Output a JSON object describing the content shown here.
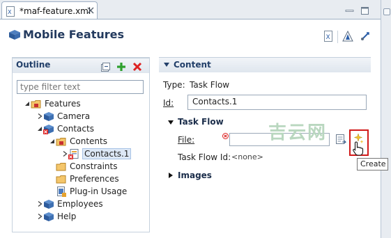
{
  "editor_tab": {
    "title": "*maf-feature.xml"
  },
  "header": {
    "title": "Mobile Features"
  },
  "outline": {
    "title": "Outline",
    "filter_placeholder": "type filter text",
    "tree": [
      {
        "label": "Features"
      },
      {
        "label": "Camera"
      },
      {
        "label": "Contacts"
      },
      {
        "label": "Contents"
      },
      {
        "label": "Contacts.1"
      },
      {
        "label": "Constraints"
      },
      {
        "label": "Preferences"
      },
      {
        "label": "Plug-in Usage"
      },
      {
        "label": "Employees"
      },
      {
        "label": "Help"
      }
    ]
  },
  "content": {
    "section_title": "Content",
    "type_label": "Type:",
    "type_value": "Task Flow",
    "id_label": "Id:",
    "id_value": "Contacts.1",
    "task_flow": {
      "title": "Task Flow",
      "file_label": "File:",
      "file_value": "",
      "task_flow_id_label": "Task Flow Id:",
      "task_flow_id_value": "<none>"
    },
    "images_title": "Images"
  },
  "tooltip": "Create",
  "watermark": "吉云网",
  "colors": {
    "accent": "#233a5e",
    "section_title": "#23406a",
    "highlight_box": "#d11a1a",
    "panel_bg": "#ffffff"
  }
}
